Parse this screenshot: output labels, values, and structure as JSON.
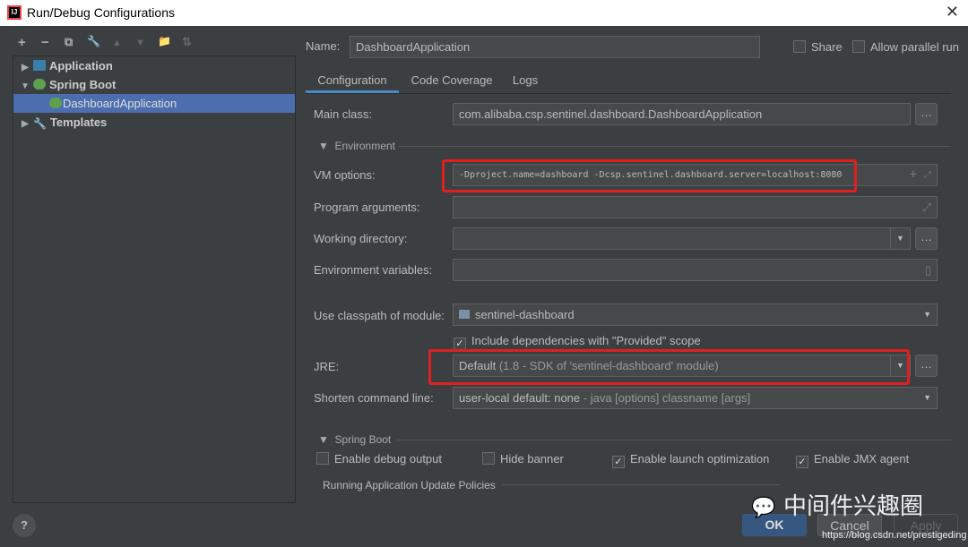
{
  "window": {
    "title": "Run/Debug Configurations",
    "close": "✕"
  },
  "toolbar": {
    "add": "+",
    "remove": "−",
    "copy": "⧉",
    "edit": "🔧",
    "up": "▲",
    "down": "▼",
    "folder": "📁",
    "sort": "⇅"
  },
  "tree": [
    {
      "label": "Application",
      "expanded": false
    },
    {
      "label": "Spring Boot",
      "expanded": true
    },
    {
      "label": "DashboardApplication",
      "selected": true
    },
    {
      "label": "Templates",
      "expanded": false
    }
  ],
  "header": {
    "name_label": "Name:",
    "name_value": "DashboardApplication",
    "share": "Share",
    "allow_parallel": "Allow parallel run"
  },
  "tabs": [
    "Configuration",
    "Code Coverage",
    "Logs"
  ],
  "form": {
    "main_class_label": "Main class:",
    "main_class": "com.alibaba.csp.sentinel.dashboard.DashboardApplication",
    "environment_section": "Environment",
    "vm_label": "VM options:",
    "vm_value": "-Dproject.name=dashboard -Dcsp.sentinel.dashboard.server=localhost:8080",
    "prog_label": "Program arguments:",
    "wd_label": "Working directory:",
    "env_label": "Environment variables:",
    "classpath_label": "Use classpath of module:",
    "classpath_value": "sentinel-dashboard",
    "include_deps": "Include dependencies with \"Provided\" scope",
    "jre_label": "JRE:",
    "jre_value": "Default",
    "jre_detail": "(1.8 - SDK of 'sentinel-dashboard' module)",
    "shorten_label": "Shorten command line:",
    "shorten_value": "user-local default: none",
    "shorten_detail": " - java [options] classname [args]",
    "spring_section": "Spring Boot",
    "debug_output": "Enable debug output",
    "hide_banner": "Hide banner",
    "launch_opt": "Enable launch optimization",
    "jmx": "Enable JMX agent",
    "update_policies": "Running Application Update Policies"
  },
  "footer": {
    "help": "?",
    "ok": "OK",
    "cancel": "Cancel",
    "apply": "Apply"
  },
  "watermark": {
    "name": "中间件兴趣圈",
    "url": "https://blog.csdn.net/prestigeding"
  },
  "colors": {
    "selection": "#4b6eaf",
    "highlight_box": "#e02020",
    "ok": "#365880"
  }
}
